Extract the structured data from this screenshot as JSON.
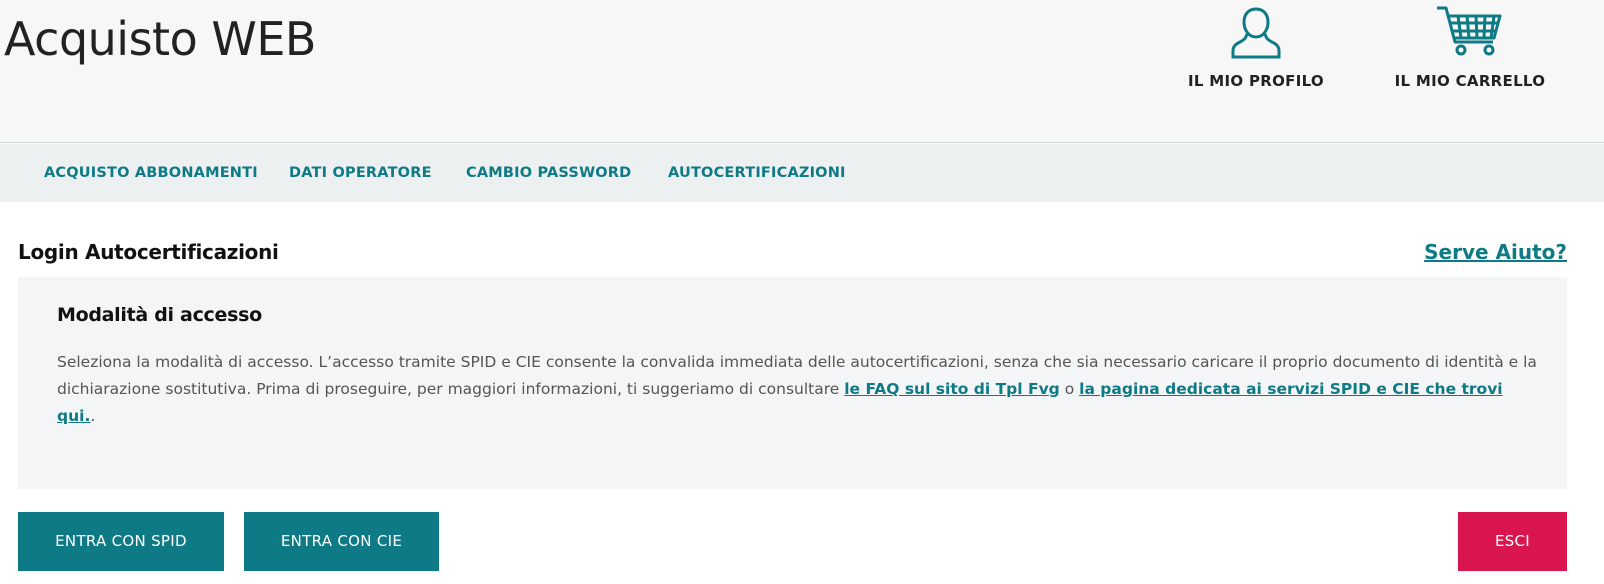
{
  "header": {
    "title": "Acquisto WEB",
    "profile_label": "IL MIO PROFILO",
    "cart_label": "IL MIO CARRELLO",
    "profile_icon": "user-icon",
    "cart_icon": "cart-icon"
  },
  "nav": {
    "items": [
      {
        "label": "ACQUISTO ABBONAMENTI"
      },
      {
        "label": "DATI OPERATORE"
      },
      {
        "label": "CAMBIO PASSWORD"
      },
      {
        "label": "AUTOCERTIFICAZIONI"
      }
    ]
  },
  "section": {
    "title": "Login Autocertificazioni",
    "help_link": "Serve Aiuto?"
  },
  "panel": {
    "title": "Modalità di accesso",
    "text_part1": "Seleziona la modalità di accesso. L’accesso tramite SPID e CIE consente la convalida immediata delle autocertificazioni, senza che sia necessario caricare il proprio documento di identità e la dichiarazione sostitutiva. Prima di proseguire, per maggiori informazioni, ti suggeriamo di consultare ",
    "link1": "le FAQ sul sito di Tpl Fvg",
    "text_part2": " o ",
    "link2": "la pagina dedicata ai servizi SPID e CIE che trovi qui.",
    "text_part3": "."
  },
  "buttons": {
    "spid": "ENTRA CON SPID",
    "cie": "ENTRA CON CIE",
    "esci": "ESCI"
  },
  "colors": {
    "accent": "#0d7a85",
    "danger": "#d91550"
  }
}
